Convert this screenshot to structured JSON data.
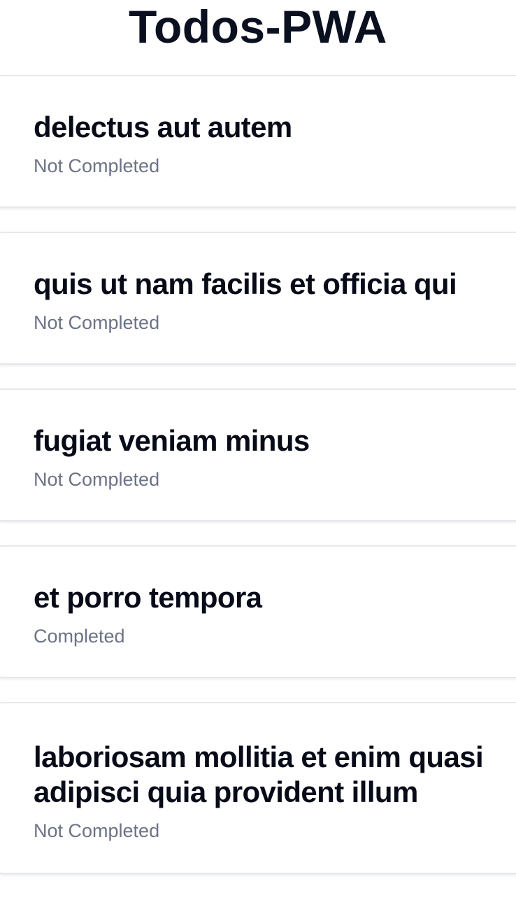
{
  "app": {
    "title": "Todos-PWA"
  },
  "todos": [
    {
      "title": "delectus aut autem",
      "status": "Not Completed"
    },
    {
      "title": "quis ut nam facilis et officia qui",
      "status": "Not Completed"
    },
    {
      "title": "fugiat veniam minus",
      "status": "Not Completed"
    },
    {
      "title": "et porro tempora",
      "status": "Completed"
    },
    {
      "title": "laboriosam mollitia et enim quasi adipisci quia provident illum",
      "status": "Not Completed"
    }
  ],
  "colors": {
    "title": "#0b1020",
    "text": "#070b18",
    "status": "#6b7385",
    "border": "#e6e8ec",
    "background": "#ffffff"
  }
}
